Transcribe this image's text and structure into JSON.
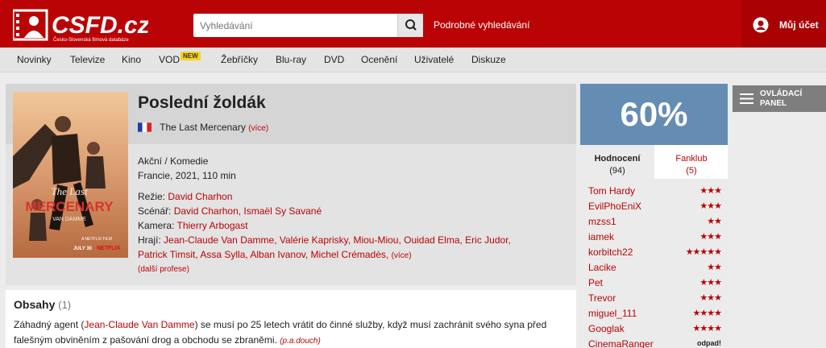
{
  "header": {
    "logo_text": "CSFD.cz",
    "logo_sub": "Česko-Slovenská filmová databáze",
    "search_placeholder": "Vyhledávání",
    "advanced_search": "Podrobné vyhledávání",
    "account": "Můj účet",
    "brand_color": "#ba0305"
  },
  "nav": {
    "items": [
      "Novinky",
      "Televize",
      "Kino",
      "VOD",
      "Žebříčky",
      "Blu-ray",
      "DVD",
      "Ocenění",
      "Uživatelé",
      "Diskuze"
    ],
    "new_badge": "NEW"
  },
  "film": {
    "title": "Poslední žoldák",
    "original_title": "The Last Mercenary",
    "more": "(více)",
    "genre": "Akční / Komedie",
    "origin": "Francie, 2021, 110 min",
    "directing_label": "Režie:",
    "directors": "David Charhon",
    "script_label": "Scénář:",
    "writers": "David Charhon, Ismaël Sy Savané",
    "camera_label": "Kamera:",
    "camera": "Thierry Arbogast",
    "cast_label": "Hrají:",
    "cast_line1": "Jean-Claude Van Damme, Valérie Kaprisky, Miou-Miou, Ouidad Elma, Eric Judor,",
    "cast_line2": "Patrick Timsit, Assa Sylla, Alban Ivanov, Michel Crémadès,",
    "cast_more": "(více)",
    "other_professions": "(další profese)",
    "poster": {
      "title_line1": "The Last",
      "title_line2": "MERCENARY",
      "subtitle": "VAN DAMME",
      "top_text": "A NETFLIX FILM",
      "date": "JULY 30",
      "network": "NETFLIX"
    }
  },
  "plots": {
    "title": "Obsahy",
    "count": "(1)",
    "text_before": "Záhadný agent (",
    "text_link": "Jean-Claude Van Damme",
    "text_after": ") se musí po 25 letech vrátit do činné služby, když musí zachránit svého syna před falešným obviněním z pašování drog a obchodu se zbraněmi.",
    "author": "(p.a.douch)"
  },
  "rating": {
    "percent": "60%",
    "color": "#658db4",
    "tab_ratings": "Hodnocení",
    "tab_ratings_count": "(94)",
    "tab_fanclub": "Fanklub",
    "tab_fanclub_count": "(5)",
    "users": [
      {
        "name": "Tom Hardy",
        "stars": "★★★"
      },
      {
        "name": "EvilPhoEniX",
        "stars": "★★★"
      },
      {
        "name": "mzss1",
        "stars": "★★"
      },
      {
        "name": "iamek",
        "stars": "★★★"
      },
      {
        "name": "korbitch22",
        "stars": "★★★★★"
      },
      {
        "name": "Lacike",
        "stars": "★★"
      },
      {
        "name": "Pet",
        "stars": "★★★"
      },
      {
        "name": "Trevor",
        "stars": "★★★"
      },
      {
        "name": "miguel_111",
        "stars": "★★★★"
      },
      {
        "name": "Googlak",
        "stars": "★★★★"
      },
      {
        "name": "CinemaRanger",
        "stars": "odpad!"
      }
    ]
  },
  "panel": {
    "line1": "OVLÁDACÍ",
    "line2": "PANEL"
  }
}
